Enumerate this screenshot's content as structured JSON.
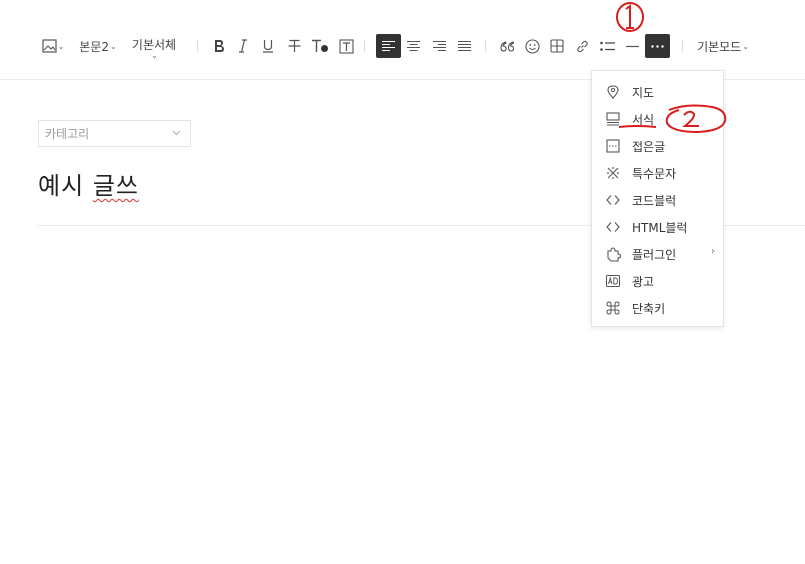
{
  "toolbar": {
    "image_caret": "⌄",
    "paragraph": "본문2",
    "paragraph_caret": "⌄",
    "font": "기본서체",
    "font_caret": "⌄",
    "mode": "기본모드",
    "mode_caret": "⌄"
  },
  "editor": {
    "category_placeholder": "카테고리",
    "title_part1": "예시",
    "title_part2": "글쓰"
  },
  "more_menu": {
    "items": [
      {
        "label": "지도",
        "icon": "map-pin-icon"
      },
      {
        "label": "서식",
        "icon": "template-icon"
      },
      {
        "label": "접은글",
        "icon": "fold-icon"
      },
      {
        "label": "특수문자",
        "icon": "special-char-icon"
      },
      {
        "label": "코드블럭",
        "icon": "code-icon"
      },
      {
        "label": "HTML블럭",
        "icon": "html-code-icon"
      },
      {
        "label": "플러그인",
        "icon": "plugin-icon",
        "submenu": "›"
      },
      {
        "label": "광고",
        "icon": "ad-icon"
      },
      {
        "label": "단축키",
        "icon": "command-icon"
      }
    ]
  },
  "annotations": {
    "step1": "1",
    "step2": "2",
    "color": "#d91c1c"
  },
  "colors": {
    "active_button": "#333333",
    "divider": "#ececec"
  }
}
